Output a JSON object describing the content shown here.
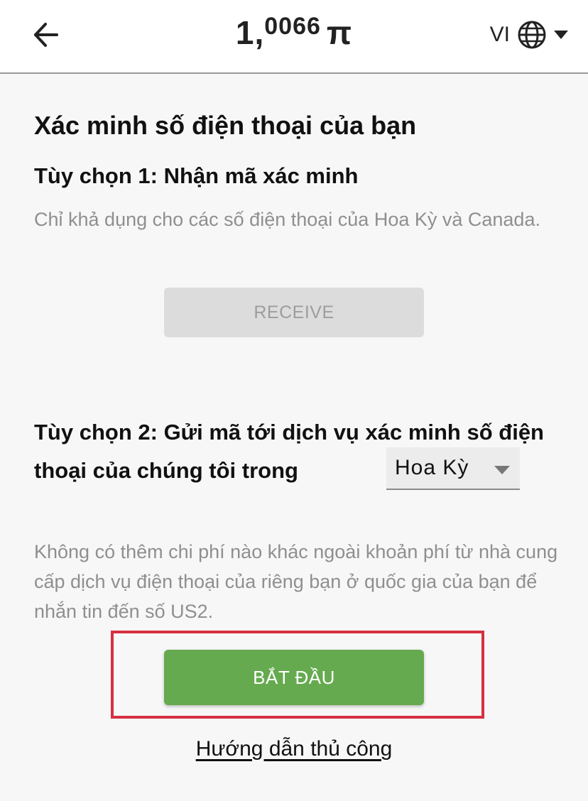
{
  "header": {
    "back_icon": "arrow-left-icon",
    "balance_int": "1,",
    "balance_dec": "0066",
    "currency_symbol": "π",
    "language_code": "VI",
    "globe_icon": "globe-icon",
    "dropdown_icon": "caret-down-icon"
  },
  "main": {
    "title": "Xác minh số điện thoại của bạn",
    "option1": {
      "title": "Tùy chọn 1: Nhận mã xác minh",
      "description": "Chỉ khả dụng cho các số điện thoại của Hoa Kỳ và Canada.",
      "button_label": "RECEIVE"
    },
    "option2": {
      "title": "Tùy chọn 2: Gửi mã tới dịch vụ xác minh số điện thoại của chúng tôi trong",
      "country_value": "Hoa Kỳ",
      "description": "Không có thêm chi phí nào khác ngoài khoản phí từ nhà cung cấp dịch vụ điện thoại của riêng bạn ở quốc gia của bạn để nhắn tin đến số US2.",
      "button_label": "BẮT ĐẦU"
    },
    "manual_link": "Hướng dẫn thủ công"
  },
  "colors": {
    "start_button": "#66aa4f",
    "highlight_border": "#d6303f",
    "muted_text": "#8f8f8f",
    "disabled_button": "#dcdcdc"
  }
}
